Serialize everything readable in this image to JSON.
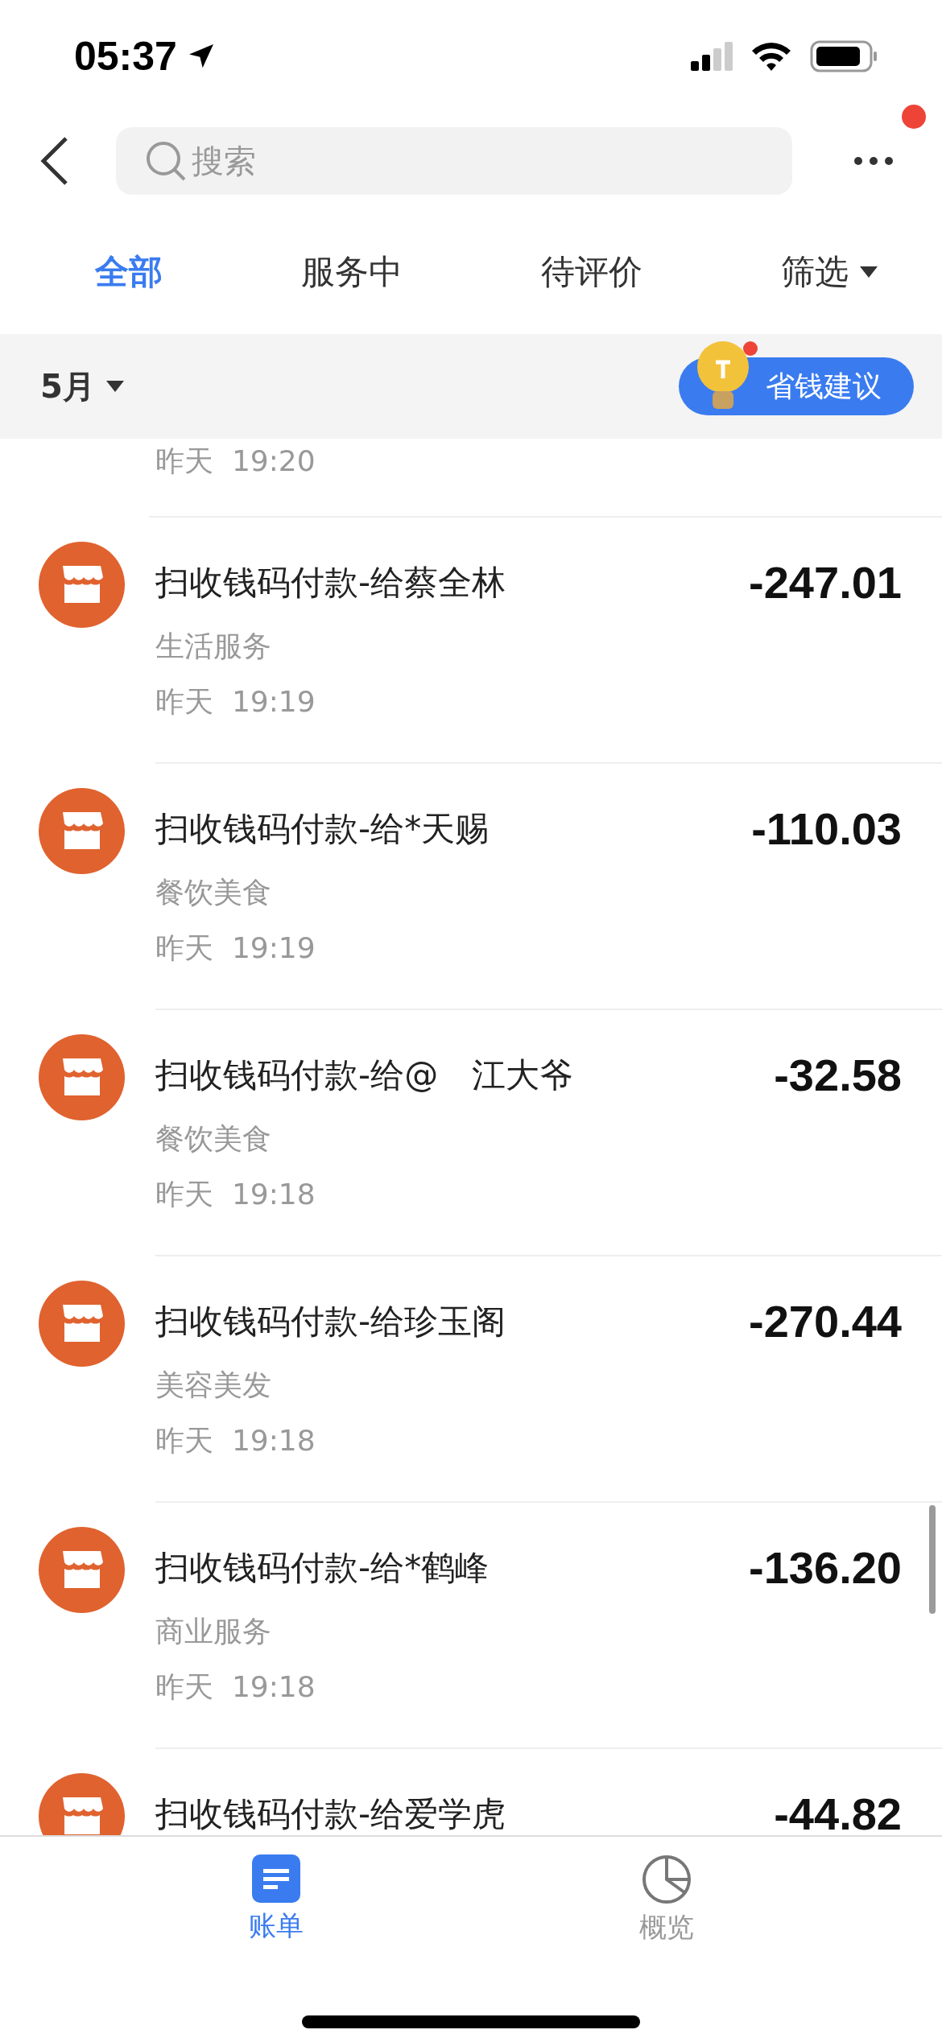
{
  "status_bar": {
    "time": "05:37"
  },
  "search": {
    "placeholder": "搜索"
  },
  "more_menu": {
    "has_badge": true
  },
  "tabs": [
    {
      "label": "全部",
      "selected": true,
      "kind": "tab"
    },
    {
      "label": "服务中",
      "selected": false,
      "kind": "tab"
    },
    {
      "label": "待评价",
      "selected": false,
      "kind": "tab"
    },
    {
      "label": "筛选",
      "selected": false,
      "kind": "dropdown"
    }
  ],
  "month_bar": {
    "month": "5月",
    "tip_button": {
      "label": "省钱建议",
      "has_badge": true
    }
  },
  "partial_row": {
    "day": "昨天",
    "time": "19:20"
  },
  "transactions": [
    {
      "title": "扫收钱码付款-给蔡全林",
      "category": "生活服务",
      "day": "昨天",
      "time": "19:19",
      "amount": "-247.01"
    },
    {
      "title": "扫收钱码付款-给*天赐",
      "category": "餐饮美食",
      "day": "昨天",
      "time": "19:19",
      "amount": "-110.03"
    },
    {
      "title": "扫收钱码付款-给@　江大爷",
      "category": "餐饮美食",
      "day": "昨天",
      "time": "19:18",
      "amount": "-32.58"
    },
    {
      "title": "扫收钱码付款-给珍玉阁",
      "category": "美容美发",
      "day": "昨天",
      "time": "19:18",
      "amount": "-270.44"
    },
    {
      "title": "扫收钱码付款-给*鹤峰",
      "category": "商业服务",
      "day": "昨天",
      "time": "19:18",
      "amount": "-136.20"
    },
    {
      "title": "扫收钱码付款-给爱学虎",
      "amount": "-44.82"
    }
  ],
  "bottom_tabs": [
    {
      "label": "账单",
      "selected": true,
      "kind": "bill"
    },
    {
      "label": "概览",
      "selected": false,
      "kind": "overview"
    }
  ]
}
